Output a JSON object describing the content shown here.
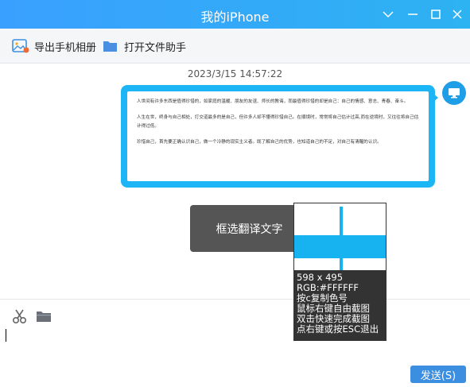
{
  "window": {
    "title": "我的iPhone"
  },
  "toolbar": {
    "export_album": "导出手机相册",
    "open_file_helper": "打开文件助手"
  },
  "chat": {
    "timestamp": "2023/3/15 14:57:22",
    "message_paragraphs": [
      "人世间有许多东西是值得珍惜的，如家庭的温暖、朋友的友谊、师长的教诲，而最值得珍惜的却是自己：自己的情感、意志、青春、奋斗。",
      "人生在世，终身与自己相处，打交道最多的是自己，但许多人却不懂得珍惜自己。在顺境时，常常将自己估计过高,而在逆境时，又往往将自己估计得过低。",
      "珍惜自己，首先要正确认识自己，做一个冷静的现实主义者。既了解自己的优势，也知道自己的不足，对自己有清醒的认识。"
    ]
  },
  "overlay": {
    "translate_button": "框选翻译文字",
    "magnifier_lines": [
      "598 x 495",
      "RGB:#FFFFFF",
      "按c复制色号",
      "鼠标右键自由截图",
      "双击快速完成截图",
      "点右键或按ESC退出"
    ]
  },
  "input": {
    "send_label": "发送(S)"
  },
  "colors": {
    "accent": "#1cb5f5",
    "titlebar": "#2db2f2",
    "send": "#3b8ee0"
  }
}
